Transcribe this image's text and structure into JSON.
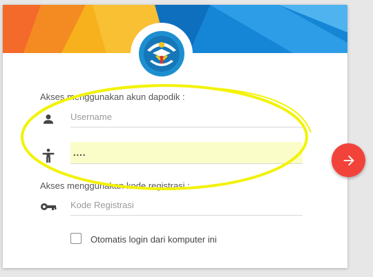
{
  "login": {
    "dapodik_label": "Akses menggunakan akun dapodik :",
    "username": {
      "value": "",
      "placeholder": "Username"
    },
    "password": {
      "value": "....",
      "masked": true
    },
    "registration_label": "Akses menggunakan kode registrasi :",
    "registration_code": {
      "value": "",
      "placeholder": "Kode Registrasi"
    },
    "remember_label": "Otomatis login dari komputer ini",
    "remember_checked": false
  },
  "colors": {
    "banner_orange": "#f7b11c",
    "banner_red": "#f36a2a",
    "banner_blue": "#1585d6",
    "submit_button": "#f2433a",
    "highlight_ellipse": "#f2f20a",
    "password_fill": "#fafdc8"
  },
  "icons": {
    "username": "person-icon",
    "password": "accessibility-icon",
    "registration": "key-icon",
    "submit": "arrow-right-icon"
  }
}
